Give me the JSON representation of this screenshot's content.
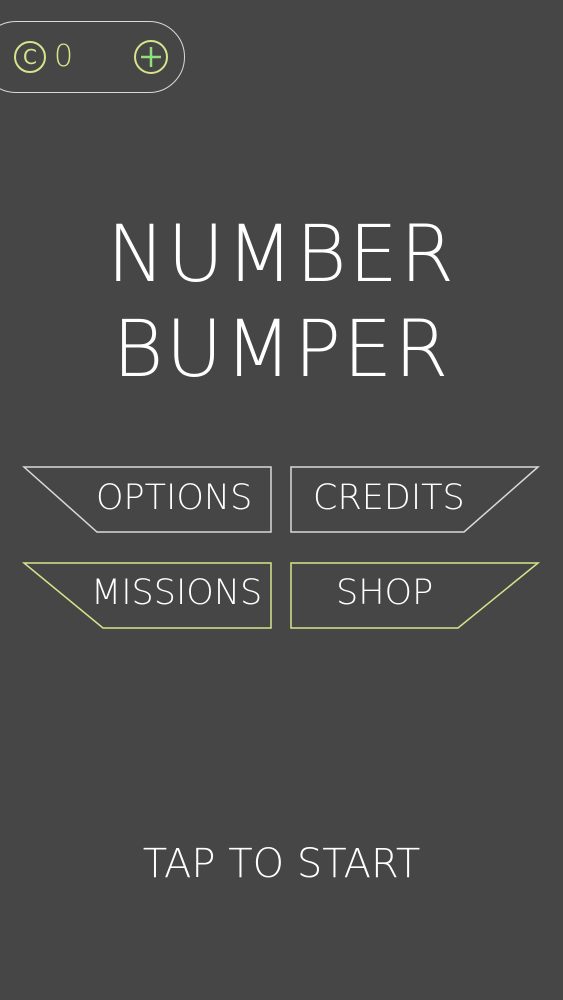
{
  "hud": {
    "coin_symbol": "C",
    "coin_count": "0",
    "add_icon": "plus-circle-icon",
    "coin_icon": "coin-icon"
  },
  "title": {
    "line1": "NUMBER",
    "line2": "BUMPER"
  },
  "menu": {
    "options_label": "OPTIONS",
    "credits_label": "CREDITS",
    "missions_label": "MISSIONS",
    "shop_label": "SHOP"
  },
  "footer": {
    "tap_label": "TAP TO START"
  },
  "colors": {
    "background": "#464646",
    "outline": "#d9d9d9",
    "accent": "#d4e58a",
    "plus": "#8fe07a"
  }
}
